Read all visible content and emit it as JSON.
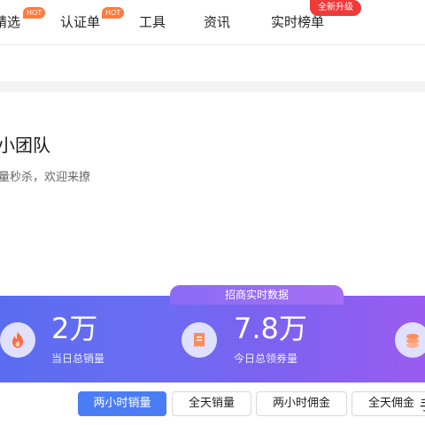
{
  "nav": {
    "items": [
      {
        "label": "精选",
        "hot": "HOT"
      },
      {
        "label": "认证单",
        "hot": "HOT"
      },
      {
        "label": "工具"
      },
      {
        "label": "资讯"
      },
      {
        "label": "实时榜单",
        "badge": "全新升级"
      }
    ]
  },
  "profile": {
    "title": "小团队",
    "subtitle": "量秒杀，欢迎来撩"
  },
  "stats": {
    "tab_label": "招商实时数据",
    "items": [
      {
        "value": "2万",
        "label": "当日总销量",
        "icon": "flame-icon"
      },
      {
        "value": "7.8万",
        "label": "今日总领券量",
        "icon": "receipt-icon"
      },
      {
        "value": "",
        "label": "",
        "icon": "coins-icon"
      }
    ]
  },
  "filters": {
    "buttons": [
      "两小时销量",
      "全天销量",
      "两小时佣金",
      "全天佣金"
    ],
    "active_index": 0,
    "edge_text": "手"
  },
  "colors": {
    "accent": "#4a7df5",
    "hot": "#ff7a3d",
    "badge": "#ef3a3a"
  }
}
